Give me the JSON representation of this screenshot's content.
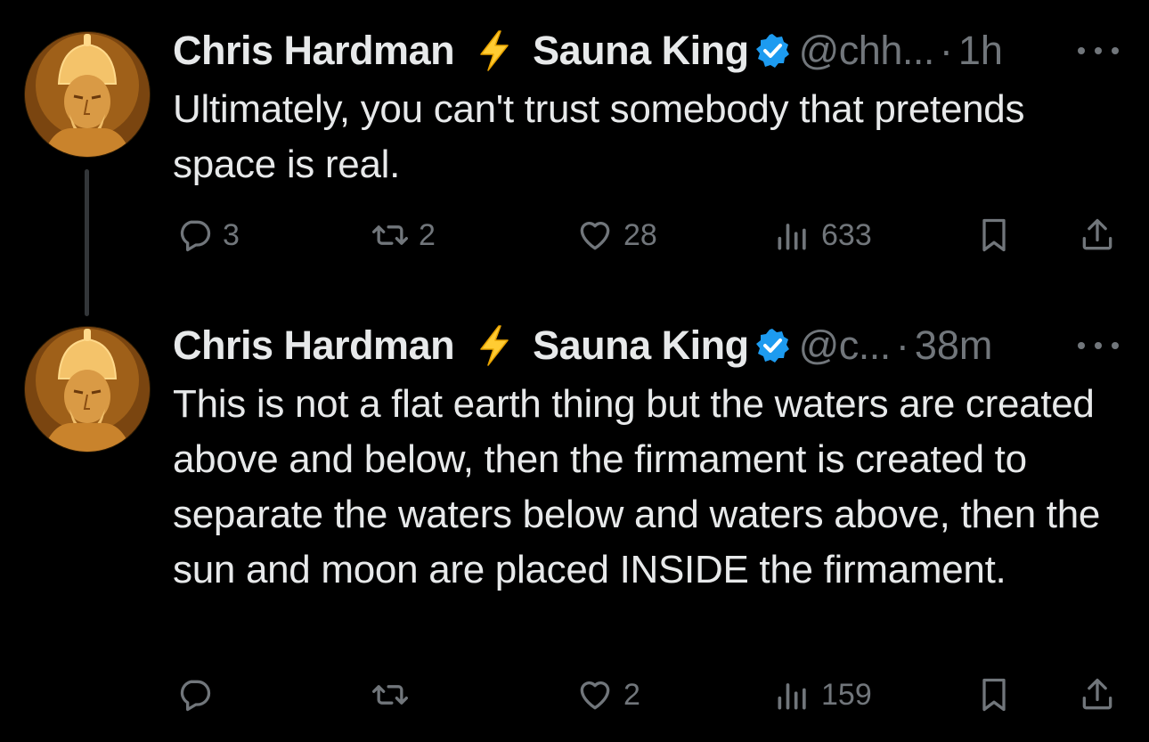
{
  "thread": {
    "tweets": [
      {
        "author": {
          "name": "Chris Hardman",
          "lightning": "⚡",
          "name_suffix": "Sauna King",
          "verified_color": "#1d9bf0",
          "avatar_icon": "bust-statue-avatar"
        },
        "handle": "@chh...",
        "separator": "·",
        "time": "1h",
        "text": "Ultimately, you can't trust somebody that pretends space is real.",
        "actions": {
          "reply": {
            "icon": "reply-icon",
            "count": "3"
          },
          "retweet": {
            "icon": "retweet-icon",
            "count": "2"
          },
          "like": {
            "icon": "heart-icon",
            "count": "28"
          },
          "views": {
            "icon": "views-icon",
            "count": "633"
          },
          "bookmark": {
            "icon": "bookmark-icon"
          },
          "share": {
            "icon": "share-icon"
          }
        }
      },
      {
        "author": {
          "name": "Chris Hardman",
          "lightning": "⚡",
          "name_suffix": "Sauna King",
          "verified_color": "#1d9bf0",
          "avatar_icon": "bust-statue-avatar"
        },
        "handle": "@c...",
        "separator": "·",
        "time": "38m",
        "text": "This is not a flat earth thing but the waters are created above and below, then the firmament is created to separate the waters below and waters above, then the sun and moon are placed INSIDE the firmament.",
        "actions": {
          "reply": {
            "icon": "reply-icon",
            "count": ""
          },
          "retweet": {
            "icon": "retweet-icon",
            "count": ""
          },
          "like": {
            "icon": "heart-icon",
            "count": "2"
          },
          "views": {
            "icon": "views-icon",
            "count": "159"
          },
          "bookmark": {
            "icon": "bookmark-icon"
          },
          "share": {
            "icon": "share-icon"
          }
        }
      }
    ]
  },
  "colors": {
    "background": "#000000",
    "text_primary": "#e7e9ea",
    "text_secondary": "#71767b",
    "verified": "#1d9bf0",
    "thread_line": "#333639"
  }
}
